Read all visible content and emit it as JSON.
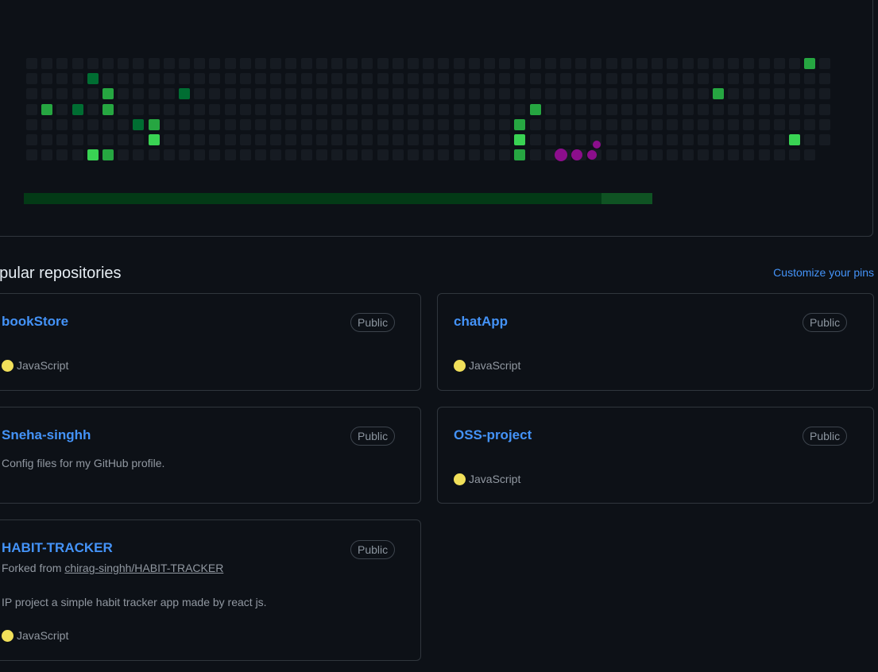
{
  "contribution_graph": {
    "colors": {
      "empty": "#161b22",
      "level1": "#0e4429",
      "level2": "#006d32",
      "level3": "#26a641",
      "level4": "#39d353",
      "highlight": "#8c0e8c"
    }
  },
  "popular_repositories": {
    "title": "opular repositories",
    "customize_label": "Customize your pins",
    "repos": [
      {
        "name": "bookStore",
        "visibility": "Public",
        "language": "JavaScript",
        "language_color": "#f1e05a"
      },
      {
        "name": "chatApp",
        "visibility": "Public",
        "language": "JavaScript",
        "language_color": "#f1e05a"
      },
      {
        "name": "Sneha-singhh",
        "visibility": "Public",
        "description": "Config files for my GitHub profile."
      },
      {
        "name": "OSS-project",
        "visibility": "Public",
        "language": "JavaScript",
        "language_color": "#f1e05a"
      },
      {
        "name": "HABIT-TRACKER",
        "visibility": "Public",
        "forked_prefix": "Forked from ",
        "forked_from": "chirag-singhh/HABIT-TRACKER",
        "description": "IP project a simple habit tracker app made by react js.",
        "language": "JavaScript",
        "language_color": "#f1e05a"
      }
    ]
  }
}
